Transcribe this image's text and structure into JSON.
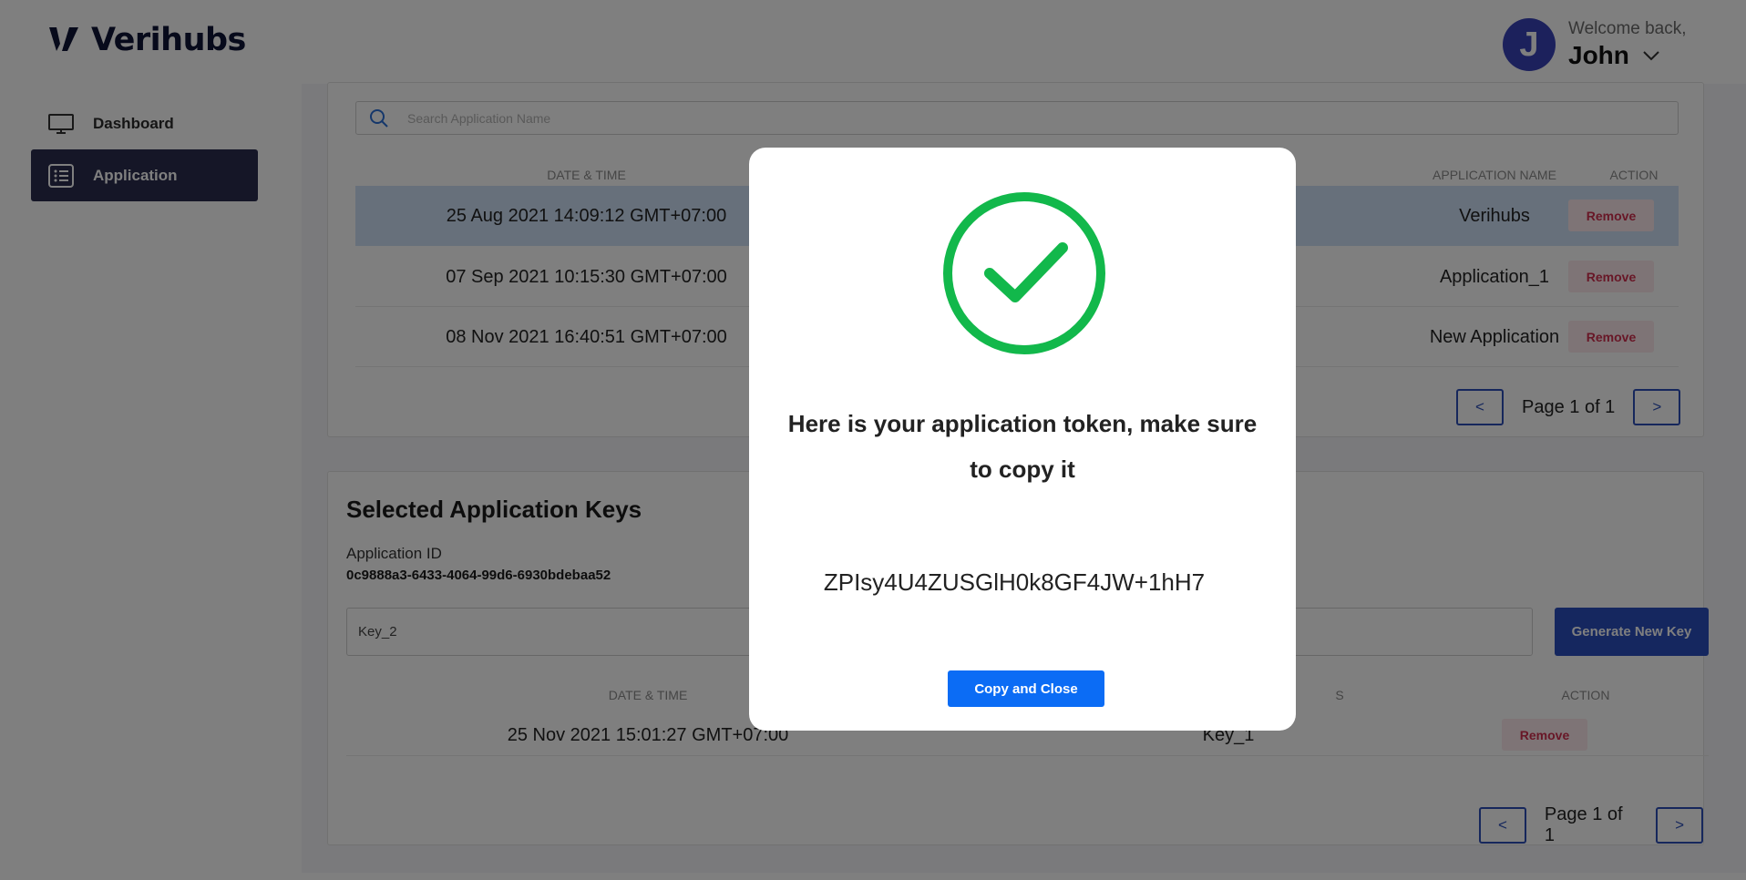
{
  "brand": {
    "name": "Verihubs"
  },
  "user": {
    "welcome": "Welcome back,",
    "name": "John",
    "initial": "J"
  },
  "sidebar": {
    "items": [
      {
        "label": "Dashboard",
        "icon": "monitor-icon",
        "active": false
      },
      {
        "label": "Application",
        "icon": "list-icon",
        "active": true
      }
    ]
  },
  "applications": {
    "search_placeholder": "Search Application Name",
    "columns": {
      "datetime": "DATE & TIME",
      "name": "APPLICATION NAME",
      "action": "ACTION"
    },
    "rows": [
      {
        "datetime": "25 Aug 2021 14:09:12 GMT+07:00",
        "name": "Verihubs",
        "action": "Remove",
        "selected": true
      },
      {
        "datetime": "07 Sep 2021 10:15:30 GMT+07:00",
        "name": "Application_1",
        "action": "Remove",
        "selected": false
      },
      {
        "datetime": "08 Nov 2021 16:40:51 GMT+07:00",
        "name": "New Application",
        "action": "Remove",
        "selected": false
      }
    ],
    "pager": {
      "prev": "<",
      "label": "Page 1 of 1",
      "next": ">"
    }
  },
  "keys": {
    "title": "Selected Application Keys",
    "app_id_label": "Application ID",
    "app_id": "0c9888a3-6433-4064-99d6-6930bdebaa52",
    "key_input_value": "Key_2",
    "generate_label": "Generate New Key",
    "columns": {
      "datetime": "DATE & TIME",
      "name_partial": "S",
      "action": "ACTION"
    },
    "rows": [
      {
        "datetime": "25 Nov 2021 15:01:27 GMT+07:00",
        "name": "Key_1",
        "action": "Remove"
      }
    ],
    "pager": {
      "prev": "<",
      "label": "Page 1 of 1",
      "next": ">"
    }
  },
  "modal": {
    "message": "Here is your application token, make sure to copy it",
    "token": "ZPIsy4U4ZUSGlH0k8GF4JW+1hH7",
    "button": "Copy and Close",
    "icon": "check-circle-icon"
  },
  "colors": {
    "brand_navy": "#0f1437",
    "sidebar_active": "#2a2c4f",
    "primary_blue": "#2b4fbf",
    "success_green": "#12b84b",
    "copy_button": "#0b6cf5",
    "remove_text": "#d12f4f"
  }
}
